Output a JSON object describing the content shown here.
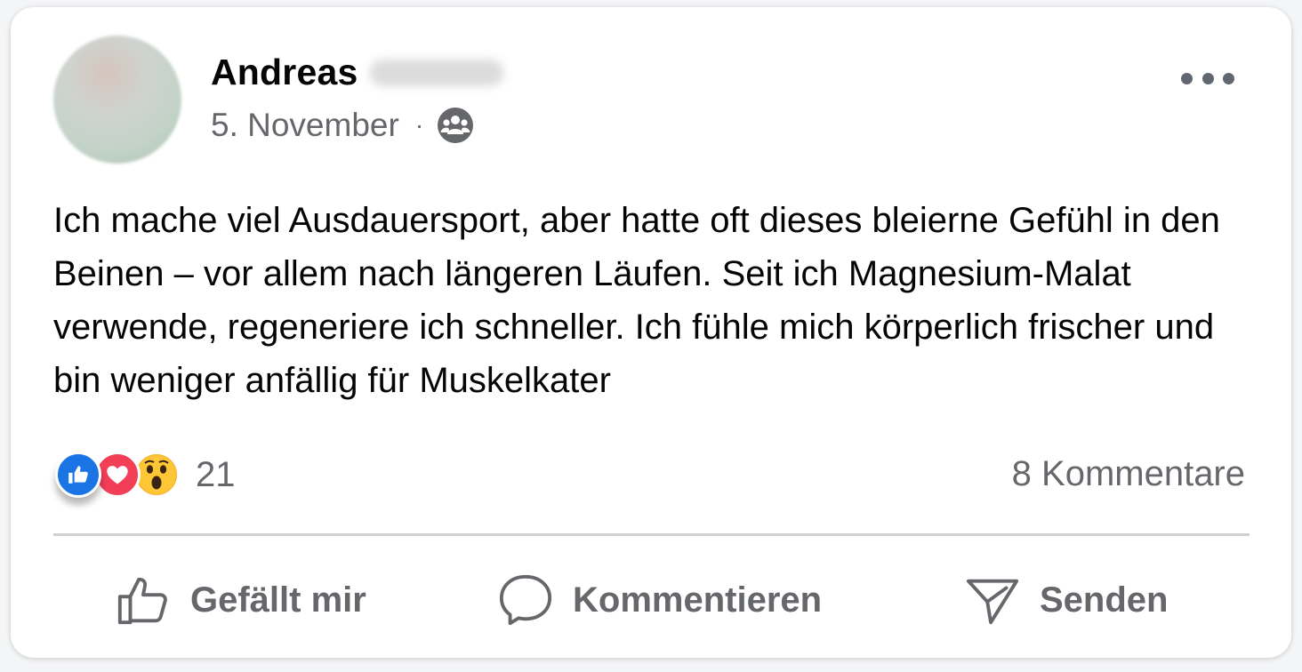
{
  "post": {
    "author_first_name": "Andreas",
    "date": "5. November",
    "separator": "·",
    "audience_icon": "group-icon",
    "text": "Ich mache viel Ausdauersport, aber hatte oft dieses bleierne Gefühl in den Beinen – vor allem nach längeren Läufen. Seit ich Magnesium-Malat verwende, regeneriere ich schneller. Ich fühle mich körperlich frischer und bin weniger anfällig für Muskelkater"
  },
  "reactions": {
    "types": [
      "like",
      "love",
      "wow"
    ],
    "count": "21"
  },
  "comments": {
    "count_label": "8 Kommentare"
  },
  "actions": {
    "like_label": "Gefällt mir",
    "comment_label": "Kommentieren",
    "send_label": "Senden"
  },
  "colors": {
    "like_blue": "#1b74e4",
    "love_red": "#f33e58",
    "wow_yellow": "#f7b125",
    "secondary_text": "#65676b"
  }
}
